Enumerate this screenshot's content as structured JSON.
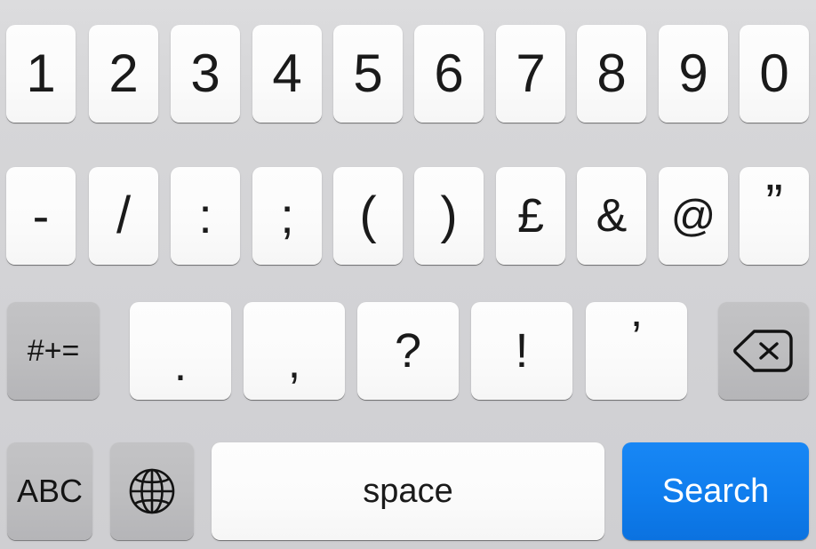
{
  "keyboard": {
    "name": "iOS numeric and symbol keyboard",
    "background_color": "#d4d4d6",
    "key_color_light": "#fbfbfb",
    "key_color_dark": "#bdbdbf",
    "accent_color": "#0f7ded",
    "label_color": "#1a1a1a",
    "accent_label_color": "#ffffff",
    "rows": [
      {
        "name": "number-row",
        "keys": [
          {
            "label": "1",
            "kind": "light",
            "type": "character"
          },
          {
            "label": "2",
            "kind": "light",
            "type": "character"
          },
          {
            "label": "3",
            "kind": "light",
            "type": "character"
          },
          {
            "label": "4",
            "kind": "light",
            "type": "character"
          },
          {
            "label": "5",
            "kind": "light",
            "type": "character"
          },
          {
            "label": "6",
            "kind": "light",
            "type": "character"
          },
          {
            "label": "7",
            "kind": "light",
            "type": "character"
          },
          {
            "label": "8",
            "kind": "light",
            "type": "character"
          },
          {
            "label": "9",
            "kind": "light",
            "type": "character"
          },
          {
            "label": "0",
            "kind": "light",
            "type": "character"
          }
        ]
      },
      {
        "name": "symbol-row",
        "keys": [
          {
            "label": "-",
            "kind": "light",
            "type": "character"
          },
          {
            "label": "/",
            "kind": "light",
            "type": "character"
          },
          {
            "label": ":",
            "kind": "light",
            "type": "character"
          },
          {
            "label": ";",
            "kind": "light",
            "type": "character"
          },
          {
            "label": "(",
            "kind": "light",
            "type": "character"
          },
          {
            "label": ")",
            "kind": "light",
            "type": "character"
          },
          {
            "label": "£",
            "kind": "light",
            "type": "character"
          },
          {
            "label": "&",
            "kind": "light",
            "type": "character"
          },
          {
            "label": "@",
            "kind": "light",
            "type": "character"
          },
          {
            "label": "”",
            "kind": "light",
            "type": "character"
          }
        ]
      },
      {
        "name": "punctuation-row",
        "keys": [
          {
            "label": "#+=",
            "kind": "dark",
            "type": "modifier"
          },
          {
            "label": ".",
            "kind": "light",
            "type": "character"
          },
          {
            "label": ",",
            "kind": "light",
            "type": "character"
          },
          {
            "label": "?",
            "kind": "light",
            "type": "character"
          },
          {
            "label": "!",
            "kind": "light",
            "type": "character"
          },
          {
            "label": "’",
            "kind": "light",
            "type": "character"
          },
          {
            "label": "",
            "kind": "dark",
            "type": "delete",
            "icon": "delete-backward-icon"
          }
        ]
      },
      {
        "name": "bottom-row",
        "keys": [
          {
            "label": "ABC",
            "kind": "dark",
            "type": "modifier"
          },
          {
            "label": "",
            "kind": "dark",
            "type": "globe",
            "icon": "globe-icon"
          },
          {
            "label": "space",
            "kind": "light",
            "type": "space"
          },
          {
            "label": "Search",
            "kind": "blue",
            "type": "action"
          }
        ]
      }
    ]
  }
}
